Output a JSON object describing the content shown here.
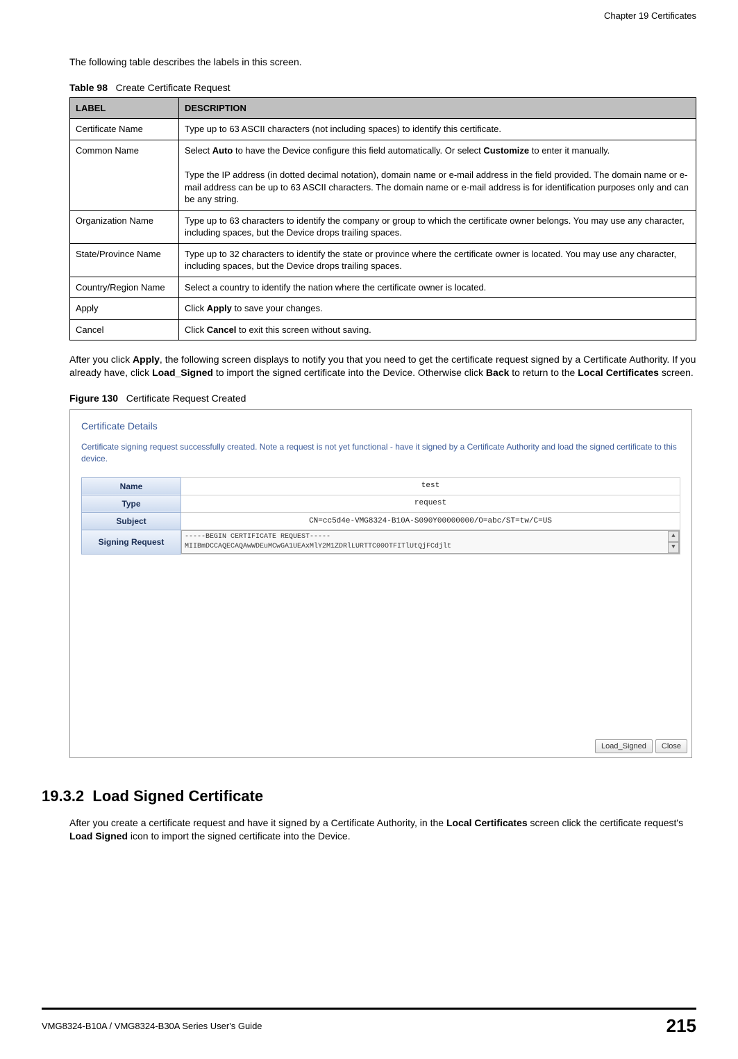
{
  "header": {
    "chapter": "Chapter 19 Certificates"
  },
  "intro": "The following table describes the labels in this screen.",
  "table_caption_prefix": "Table 98",
  "table_caption_title": "Create Certificate Request",
  "columns": {
    "label": "LABEL",
    "desc": "DESCRIPTION"
  },
  "rows": [
    {
      "label": "Certificate Name",
      "desc": "Type up to 63 ASCII characters (not including spaces) to identify this certificate."
    },
    {
      "label": "Common Name",
      "desc": "Select Auto to have the Device configure this field automatically. Or select Customize to enter it manually.\n\nType the IP address (in dotted decimal notation), domain name or e-mail address in the field provided. The domain name or e-mail address can be up to 63 ASCII characters. The domain name or e-mail address is for identification purposes only and can be any string."
    },
    {
      "label": "Organization Name",
      "desc": "Type up to 63 characters to identify the company or group to which the certificate owner belongs. You may use any character, including spaces, but the Device drops trailing spaces."
    },
    {
      "label": "State/Province Name",
      "desc": "Type up to 32 characters to identify the state or province where the certificate owner is located. You may use any character, including spaces, but the Device drops trailing spaces."
    },
    {
      "label": "Country/Region Name",
      "desc": "Select a country to identify the nation where the certificate owner is located."
    },
    {
      "label": "Apply",
      "desc": "Click Apply to save your changes."
    },
    {
      "label": "Cancel",
      "desc": "Click Cancel to exit this screen without saving."
    }
  ],
  "after_para": "After you click Apply, the following screen displays to notify you that you need to get the certificate request signed by a Certificate Authority. If you already have, click Load_Signed to import the signed certificate into the Device. Otherwise click Back to return to the Local Certificates screen.",
  "figure_caption_prefix": "Figure 130",
  "figure_caption_title": "Certificate Request Created",
  "modal": {
    "title": "Certificate Details",
    "message": "Certificate signing request successfully created. Note a request is not yet functional - have it signed by a Certificate Authority and load the signed certificate to this device.",
    "rows": {
      "name_k": "Name",
      "name_v": "test",
      "type_k": "Type",
      "type_v": "request",
      "subject_k": "Subject",
      "subject_v": "CN=cc5d4e-VMG8324-B10A-S090Y00000000/O=abc/ST=tw/C=US",
      "signreq_k": "Signing Request",
      "signreq_v": "-----BEGIN CERTIFICATE REQUEST-----\nMIIBmDCCAQECAQAwWDEuMCwGA1UEAxMlY2M1ZDRlLURTTC00OTFITlUtQjFCdjlt"
    },
    "buttons": {
      "load": "Load_Signed",
      "close": "Close"
    }
  },
  "section": {
    "number": "19.3.2",
    "title": "Load Signed Certificate",
    "para": "After you create a certificate request and have it signed by a Certificate Authority, in the Local Certificates screen click the certificate request's Load Signed icon to import the signed certificate into the Device."
  },
  "footer": {
    "guide": "VMG8324-B10A / VMG8324-B30A Series User's Guide",
    "page": "215"
  }
}
